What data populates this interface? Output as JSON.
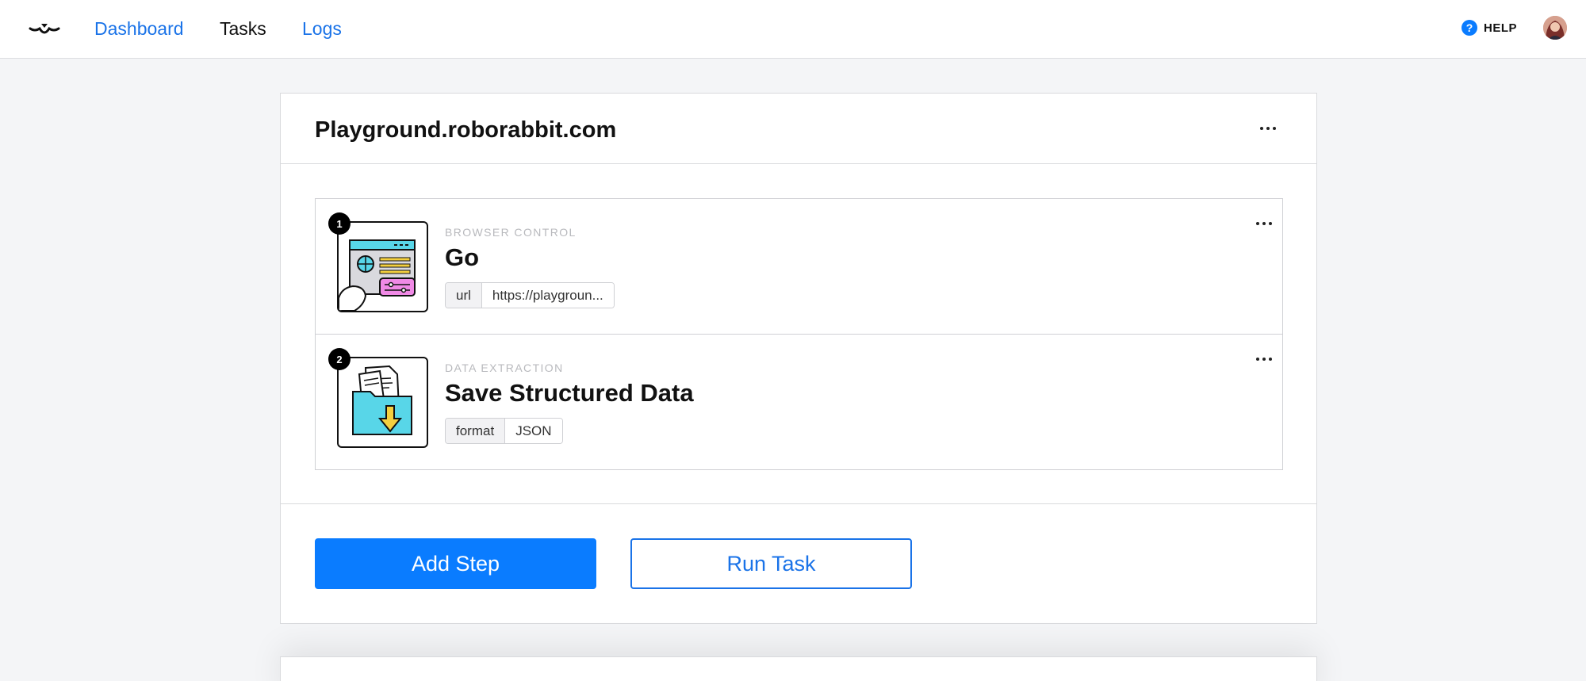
{
  "nav": {
    "logo_icon": "rabbit-logo-icon",
    "links": [
      {
        "label": "Dashboard",
        "active": false
      },
      {
        "label": "Tasks",
        "active": true
      },
      {
        "label": "Logs",
        "active": false
      }
    ],
    "help_label": "HELP",
    "help_icon": "question-circle-icon"
  },
  "task": {
    "title": "Playground.roborabbit.com",
    "steps": [
      {
        "number": "1",
        "category": "BROWSER CONTROL",
        "name": "Go",
        "thumb_icon": "browser-window-icon",
        "param_key": "url",
        "param_value": "https://playgroun..."
      },
      {
        "number": "2",
        "category": "DATA EXTRACTION",
        "name": "Save Structured Data",
        "thumb_icon": "folder-download-icon",
        "param_key": "format",
        "param_value": "JSON"
      }
    ],
    "add_step_label": "Add Step",
    "run_task_label": "Run Task"
  },
  "colors": {
    "accent": "#0a7cff",
    "link": "#1a73e8",
    "background": "#f4f5f7"
  }
}
